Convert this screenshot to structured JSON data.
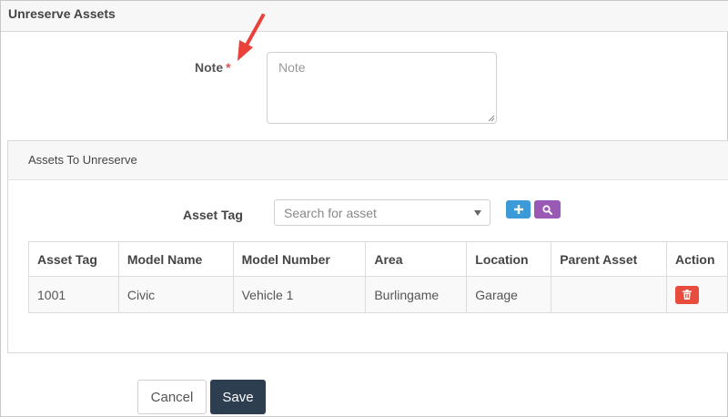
{
  "page": {
    "title": "Unreserve Assets"
  },
  "note": {
    "label": "Note",
    "required_marker": "*",
    "placeholder": "Note",
    "value": ""
  },
  "assets_panel": {
    "title": "Assets To Unreserve",
    "asset_tag_label": "Asset Tag",
    "search_placeholder": "Search for asset"
  },
  "table": {
    "headers": [
      "Asset Tag",
      "Model Name",
      "Model Number",
      "Area",
      "Location",
      "Parent Asset",
      "Action"
    ],
    "rows": [
      {
        "asset_tag": "1001",
        "model_name": "Civic",
        "model_number": "Vehicle 1",
        "area": "Burlingame",
        "location": "Garage",
        "parent_asset": ""
      }
    ]
  },
  "actions": {
    "cancel_label": "Cancel",
    "save_label": "Save"
  },
  "colors": {
    "required": "#d9534f",
    "annotation_arrow": "#e8423a",
    "add_button": "#3c9ad8",
    "search_button": "#9b59b6",
    "delete_button": "#e74c3c",
    "save_button": "#2c3e50"
  },
  "icons": {
    "add": "plus-icon",
    "search": "magnifier-icon",
    "delete": "trash-icon",
    "dropdown": "caret-down-icon",
    "annotation": "arrow-icon"
  }
}
